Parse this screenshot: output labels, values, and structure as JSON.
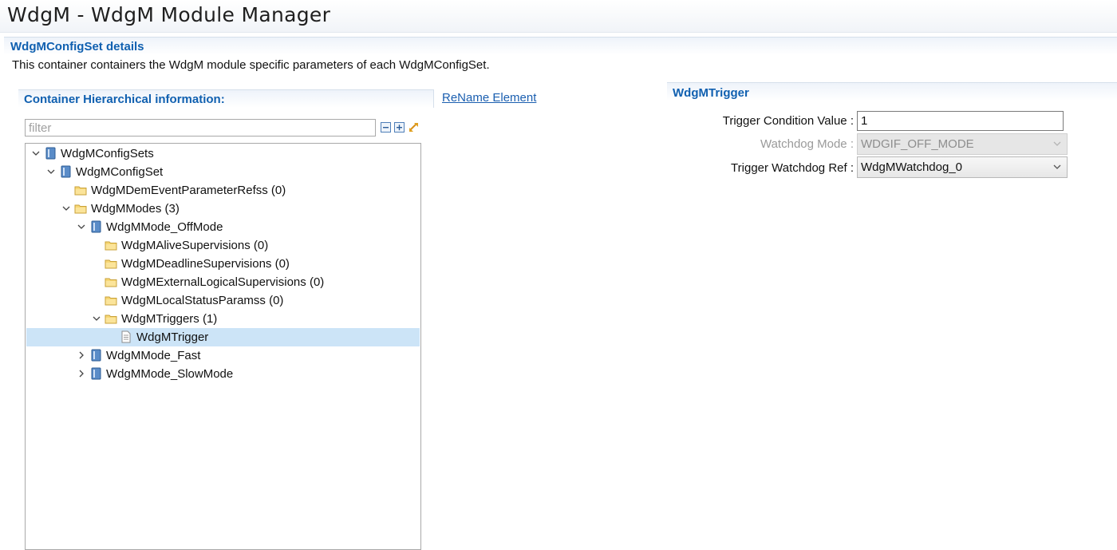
{
  "window": {
    "title": "WdgM - WdgM Module Manager"
  },
  "section": {
    "title": "WdgMConfigSet details",
    "description": "This container containers the WdgM module specific parameters of each WdgMConfigSet."
  },
  "hierarchy": {
    "title": "Container Hierarchical information:",
    "filter_placeholder": "filter",
    "filter_value": ""
  },
  "rename_link": "ReName Element",
  "tree": {
    "items": [
      {
        "label": "WdgMConfigSets",
        "icon": "container-icon",
        "expander": "expanded"
      },
      {
        "label": "WdgMConfigSet",
        "icon": "container-icon",
        "expander": "expanded"
      },
      {
        "label": "WdgMDemEventParameterRefss (0)",
        "icon": "folder-icon",
        "expander": "none"
      },
      {
        "label": "WdgMModes (3)",
        "icon": "folder-icon",
        "expander": "expanded"
      },
      {
        "label": "WdgMMode_OffMode",
        "icon": "container-icon",
        "expander": "expanded"
      },
      {
        "label": "WdgMAliveSupervisions (0)",
        "icon": "folder-icon",
        "expander": "none"
      },
      {
        "label": "WdgMDeadlineSupervisions (0)",
        "icon": "folder-icon",
        "expander": "none"
      },
      {
        "label": "WdgMExternalLogicalSupervisions (0)",
        "icon": "folder-icon",
        "expander": "none"
      },
      {
        "label": "WdgMLocalStatusParamss (0)",
        "icon": "folder-icon",
        "expander": "none"
      },
      {
        "label": "WdgMTriggers (1)",
        "icon": "folder-icon",
        "expander": "expanded"
      },
      {
        "label": "WdgMTrigger",
        "icon": "document-icon",
        "expander": "none",
        "selected": true
      },
      {
        "label": "WdgMMode_Fast",
        "icon": "container-icon",
        "expander": "collapsed"
      },
      {
        "label": "WdgMMode_SlowMode",
        "icon": "container-icon",
        "expander": "collapsed"
      }
    ]
  },
  "trigger_panel": {
    "title": "WdgMTrigger",
    "condition_label": "Trigger Condition Value :",
    "condition_value": "1",
    "mode_label": "Watchdog Mode :",
    "mode_value": "WDGIF_OFF_MODE",
    "ref_label": "Trigger Watchdog Ref :",
    "ref_value": "WdgMWatchdog_0"
  },
  "colors": {
    "section_title": "#1060b0",
    "link": "#1b5fb0",
    "selection": "#cce4f7"
  }
}
